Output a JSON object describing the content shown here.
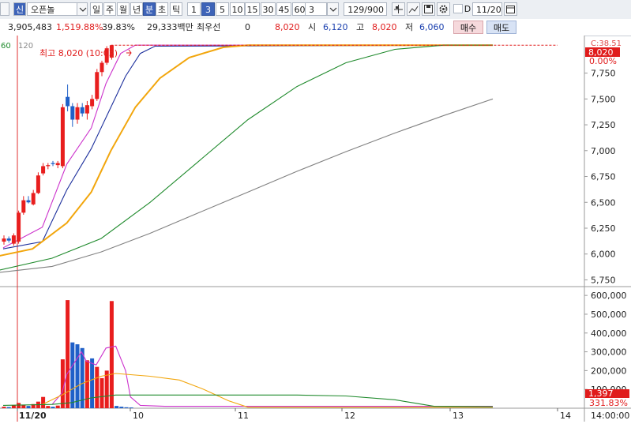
{
  "toolbar": {
    "code_badge": "신",
    "stock_name": "오픈놀",
    "periods": [
      "일",
      "주",
      "월",
      "년",
      "분",
      "초",
      "틱"
    ],
    "selected_period": "분",
    "intervals": [
      "1",
      "3",
      "5",
      "10",
      "15",
      "30",
      "45",
      "60"
    ],
    "selected_interval": "3",
    "interval_value": "3",
    "count_value": "129/900",
    "date_checkbox_label": "D",
    "date_value": "11/20"
  },
  "quote": {
    "volume": "3,905,483",
    "volume_ratio": "1,519.88%",
    "turnover": "39.83%",
    "amount": "29,333백만",
    "priority_label": "최우선",
    "priority_value": "0",
    "current_price": "8,020",
    "open_label": "시",
    "open_value": "6,120",
    "high_label": "고",
    "high_value": "8,020",
    "low_label": "저",
    "low_value": "6,060",
    "buy_label": "매수",
    "sell_label": "매도"
  },
  "chart_data": [
    {
      "type": "candlestick",
      "title": "",
      "legend": [
        "60",
        "120"
      ],
      "annotation": "최고 8,020 (10:03)",
      "price_axis_labels": [
        "7,750",
        "7,500",
        "7,250",
        "7,000",
        "6,750",
        "6,500",
        "6,250",
        "6,000",
        "5,750"
      ],
      "right_labels": {
        "top": "C:38.51",
        "price": "8,020",
        "change": "0.00%"
      },
      "ylim": [
        5700,
        8060
      ],
      "x_labels": [
        "11/20",
        "10",
        "11",
        "12",
        "13",
        "14"
      ],
      "candles": [
        {
          "o": 6120,
          "h": 6180,
          "l": 6090,
          "c": 6150,
          "color": "red"
        },
        {
          "o": 6150,
          "h": 6170,
          "l": 6110,
          "c": 6130,
          "color": "blue"
        },
        {
          "o": 6100,
          "h": 6200,
          "l": 6080,
          "c": 6180,
          "color": "red"
        },
        {
          "o": 6120,
          "h": 6420,
          "l": 6100,
          "c": 6400,
          "color": "red"
        },
        {
          "o": 6400,
          "h": 6560,
          "l": 6380,
          "c": 6520,
          "color": "red"
        },
        {
          "o": 6520,
          "h": 6560,
          "l": 6490,
          "c": 6500,
          "color": "blue"
        },
        {
          "o": 6480,
          "h": 6620,
          "l": 6470,
          "c": 6590,
          "color": "red"
        },
        {
          "o": 6590,
          "h": 6790,
          "l": 6580,
          "c": 6760,
          "color": "red"
        },
        {
          "o": 6780,
          "h": 6880,
          "l": 6760,
          "c": 6850,
          "color": "red"
        },
        {
          "o": 6850,
          "h": 6880,
          "l": 6820,
          "c": 6860,
          "color": "red"
        },
        {
          "o": 6880,
          "h": 6900,
          "l": 6850,
          "c": 6870,
          "color": "blue"
        },
        {
          "o": 6860,
          "h": 6900,
          "l": 6830,
          "c": 6880,
          "color": "red"
        },
        {
          "o": 6850,
          "h": 7450,
          "l": 6830,
          "c": 7420,
          "color": "red"
        },
        {
          "o": 7520,
          "h": 7640,
          "l": 7380,
          "c": 7430,
          "color": "blue"
        },
        {
          "o": 7430,
          "h": 7460,
          "l": 7230,
          "c": 7300,
          "color": "blue"
        },
        {
          "o": 7300,
          "h": 7460,
          "l": 7260,
          "c": 7420,
          "color": "red"
        },
        {
          "o": 7420,
          "h": 7460,
          "l": 7330,
          "c": 7360,
          "color": "blue"
        },
        {
          "o": 7360,
          "h": 7480,
          "l": 7300,
          "c": 7440,
          "color": "red"
        },
        {
          "o": 7430,
          "h": 7540,
          "l": 7400,
          "c": 7500,
          "color": "red"
        },
        {
          "o": 7500,
          "h": 7790,
          "l": 7480,
          "c": 7760,
          "color": "red"
        },
        {
          "o": 7760,
          "h": 7870,
          "l": 7720,
          "c": 7850,
          "color": "red"
        },
        {
          "o": 7850,
          "h": 8010,
          "l": 7830,
          "c": 7990,
          "color": "red"
        },
        {
          "o": 7900,
          "h": 8020,
          "l": 7880,
          "c": 8020,
          "color": "red"
        }
      ],
      "ma_lines": [
        {
          "name": "ma-magenta",
          "color": "#cc33cc",
          "points": [
            [
              0,
              6060
            ],
            [
              8,
              6260
            ],
            [
              13,
              6870
            ],
            [
              18,
              7220
            ],
            [
              21,
              7650
            ],
            [
              24,
              7940
            ],
            [
              27,
              8020
            ],
            [
              100,
              8020
            ]
          ]
        },
        {
          "name": "ma-navy",
          "color": "#1c2f9c",
          "points": [
            [
              0,
              6050
            ],
            [
              8,
              6120
            ],
            [
              13,
              6620
            ],
            [
              18,
              7020
            ],
            [
              21,
              7320
            ],
            [
              25,
              7720
            ],
            [
              28,
              7940
            ],
            [
              31,
              8010
            ],
            [
              100,
              8020
            ]
          ]
        },
        {
          "name": "ma-orange",
          "color": "#f2a60d",
          "points": [
            [
              -3,
              5960
            ],
            [
              6,
              6050
            ],
            [
              13,
              6300
            ],
            [
              18,
              6600
            ],
            [
              22,
              7000
            ],
            [
              27,
              7420
            ],
            [
              32,
              7700
            ],
            [
              38,
              7900
            ],
            [
              45,
              8000
            ],
            [
              50,
              8020
            ],
            [
              100,
              8020
            ]
          ]
        },
        {
          "name": "ma-green",
          "color": "#1f8a2c",
          "points": [
            [
              -3,
              5820
            ],
            [
              10,
              5960
            ],
            [
              20,
              6150
            ],
            [
              30,
              6500
            ],
            [
              40,
              6900
            ],
            [
              50,
              7300
            ],
            [
              60,
              7620
            ],
            [
              70,
              7850
            ],
            [
              80,
              7980
            ],
            [
              90,
              8020
            ],
            [
              100,
              8020
            ]
          ]
        },
        {
          "name": "ma-grey",
          "color": "#808080",
          "points": [
            [
              -3,
              5810
            ],
            [
              10,
              5880
            ],
            [
              20,
              6020
            ],
            [
              30,
              6200
            ],
            [
              40,
              6400
            ],
            [
              50,
              6600
            ],
            [
              60,
              6800
            ],
            [
              70,
              6990
            ],
            [
              80,
              7170
            ],
            [
              90,
              7340
            ],
            [
              100,
              7500
            ]
          ]
        }
      ]
    },
    {
      "type": "bar",
      "title": "",
      "volume_axis_labels": [
        "600,000",
        "500,000",
        "400,000",
        "300,000",
        "200,000",
        "100,000"
      ],
      "right_labels": {
        "volume": "1,397",
        "ratio": "331.83%"
      },
      "ylim": [
        0,
        630000
      ],
      "volumes": [
        {
          "v": 8000,
          "color": "red"
        },
        {
          "v": 6000,
          "color": "blue"
        },
        {
          "v": 15000,
          "color": "red"
        },
        {
          "v": 28000,
          "color": "red"
        },
        {
          "v": 18000,
          "color": "red"
        },
        {
          "v": 12000,
          "color": "blue"
        },
        {
          "v": 22000,
          "color": "red"
        },
        {
          "v": 35000,
          "color": "red"
        },
        {
          "v": 60000,
          "color": "red"
        },
        {
          "v": 12000,
          "color": "red"
        },
        {
          "v": 8000,
          "color": "blue"
        },
        {
          "v": 14000,
          "color": "red"
        },
        {
          "v": 260000,
          "color": "red"
        },
        {
          "v": 575000,
          "color": "red"
        },
        {
          "v": 350000,
          "color": "blue"
        },
        {
          "v": 340000,
          "color": "blue"
        },
        {
          "v": 320000,
          "color": "blue"
        },
        {
          "v": 255000,
          "color": "red"
        },
        {
          "v": 265000,
          "color": "blue"
        },
        {
          "v": 220000,
          "color": "red"
        },
        {
          "v": 160000,
          "color": "red"
        },
        {
          "v": 200000,
          "color": "red"
        },
        {
          "v": 570000,
          "color": "red"
        },
        {
          "v": 12000,
          "color": "blue"
        },
        {
          "v": 8000,
          "color": "blue"
        },
        {
          "v": 5000,
          "color": "blue"
        },
        {
          "v": 4000,
          "color": "blue"
        }
      ],
      "vol_ma_lines": [
        {
          "name": "vol-ma-magenta",
          "color": "#cc33cc",
          "points": [
            [
              10,
              20000
            ],
            [
              12,
              80000
            ],
            [
              13,
              180000
            ],
            [
              15,
              260000
            ],
            [
              16,
              300000
            ],
            [
              17,
              250000
            ],
            [
              19,
              230000
            ],
            [
              21,
              320000
            ],
            [
              23,
              330000
            ],
            [
              25,
              200000
            ],
            [
              26,
              60000
            ],
            [
              28,
              15000
            ],
            [
              33,
              10000
            ],
            [
              100,
              10000
            ]
          ]
        },
        {
          "name": "vol-ma-orange",
          "color": "#f2a60d",
          "points": [
            [
              8,
              20000
            ],
            [
              12,
              70000
            ],
            [
              16,
              130000
            ],
            [
              20,
              170000
            ],
            [
              23,
              185000
            ],
            [
              30,
              170000
            ],
            [
              36,
              150000
            ],
            [
              41,
              100000
            ],
            [
              46,
              40000
            ],
            [
              50,
              5000
            ],
            [
              100,
              5000
            ]
          ]
        },
        {
          "name": "vol-ma-green",
          "color": "#1f8a2c",
          "points": [
            [
              0,
              15000
            ],
            [
              10,
              20000
            ],
            [
              14,
              30000
            ],
            [
              18,
              55000
            ],
            [
              23,
              70000
            ],
            [
              60,
              70000
            ],
            [
              70,
              65000
            ],
            [
              80,
              45000
            ],
            [
              88,
              10000
            ],
            [
              100,
              8000
            ]
          ]
        }
      ]
    }
  ]
}
